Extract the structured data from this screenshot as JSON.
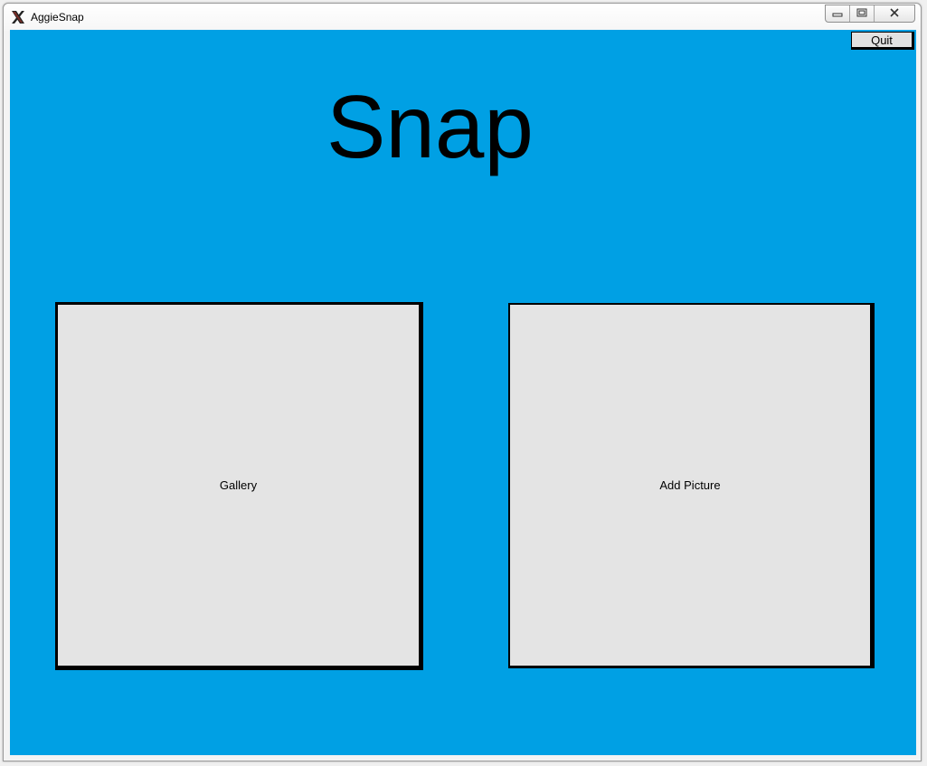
{
  "window": {
    "title": "AggieSnap",
    "icon": "x-window-icon"
  },
  "controls": {
    "minimize_icon": "minimize-icon",
    "maximize_icon": "maximize-icon",
    "close_icon": "close-icon"
  },
  "app": {
    "background_color": "#00a0e4",
    "quit_label": "Quit",
    "heading": "Snap",
    "gallery_label": "Gallery",
    "add_picture_label": "Add Picture"
  }
}
